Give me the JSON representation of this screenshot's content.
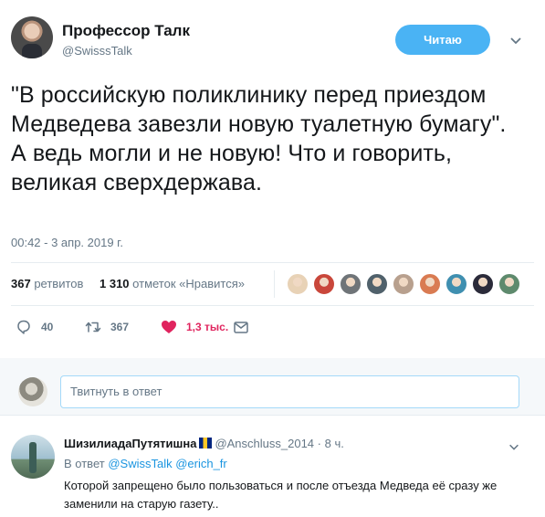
{
  "author": {
    "name": "Профессор Талк",
    "handle": "@SwisssTalk"
  },
  "follow_button": "Читаю",
  "tweet": {
    "text": "\"В российскую поликлинику перед приездом Медведева завезли новую туалетную бумагу\". А ведь могли и не новую! Что и говорить, великая сверхдержава.",
    "timestamp": "00:42 - 3 апр. 2019 г."
  },
  "stats": {
    "retweets_count": "367",
    "retweets_label": "ретвитов",
    "likes_count": "1 310",
    "likes_label": "отметок «Нравится»"
  },
  "liker_faces": [
    "#e8d2b6",
    "#c9473b",
    "#6f7478",
    "#50616b",
    "#b8a08e",
    "#d97b52",
    "#3f8fb0",
    "#2b2b3a",
    "#5e8a6d"
  ],
  "actions": {
    "replies": "40",
    "retweets": "367",
    "likes": "1,3 тыс."
  },
  "reply_box": {
    "placeholder": "Твитнуть в ответ"
  },
  "comment": {
    "name": "ШизилиадаПутятишна",
    "handle": "@Anschluss_2014",
    "separator": "·",
    "time": "8 ч.",
    "reply_to_label": "В ответ",
    "reply_to_users": "@SwissTalk @erich_fr",
    "text": "Которой запрещено было пользоваться и после отъезда Медведа её сразу же заменили на старую газету.."
  },
  "colors": {
    "accent": "#1da1f2",
    "follow_bg": "#4ab3f4",
    "like": "#e0245e",
    "muted": "#657786"
  }
}
